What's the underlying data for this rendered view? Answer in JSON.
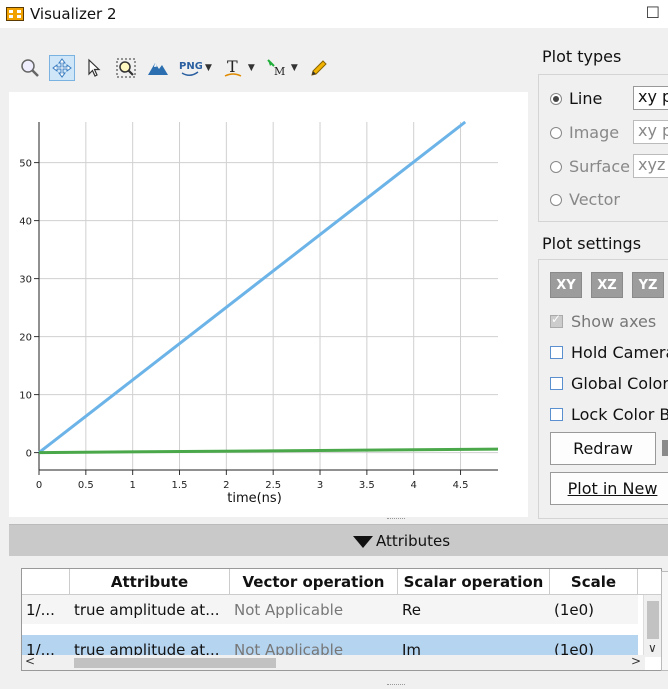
{
  "window": {
    "title": "Visualizer 2",
    "restore_glyph": "☐"
  },
  "toolbar": {
    "items": [
      {
        "name": "zoom-icon",
        "active": false
      },
      {
        "name": "pan-icon",
        "active": true
      },
      {
        "name": "select-cursor-icon",
        "active": false
      },
      {
        "name": "zoom-region-icon",
        "active": false
      },
      {
        "name": "mountain-icon",
        "active": false
      },
      {
        "name": "png-export-icon",
        "label": "PNG",
        "dropdown": true
      },
      {
        "name": "text-annotation-icon",
        "label": "T",
        "dropdown": true
      },
      {
        "name": "marker-icon",
        "label": "M",
        "dropdown": true
      },
      {
        "name": "pencil-icon",
        "active": false
      }
    ]
  },
  "chart_data": {
    "type": "line",
    "xlabel": "time(ns)",
    "xlim": [
      0,
      4.9
    ],
    "ylim": [
      -3,
      57
    ],
    "xticks": [
      0,
      0.5,
      1,
      1.5,
      2,
      2.5,
      3,
      3.5,
      4,
      4.5
    ],
    "yticks": [
      0,
      10,
      20,
      30,
      40,
      50
    ],
    "grid": true,
    "series": [
      {
        "x": [
          0,
          4.55
        ],
        "y": [
          0,
          57
        ],
        "color": "#6cb4e8"
      },
      {
        "x": [
          0,
          4.9
        ],
        "y": [
          0,
          0.6
        ],
        "color": "#4aa84a"
      }
    ]
  },
  "plot_types": {
    "title": "Plot types",
    "options": [
      {
        "label": "Line",
        "selected": true,
        "enabled": true,
        "input": "xy p"
      },
      {
        "label": "Image",
        "selected": false,
        "enabled": false,
        "input": "xy p"
      },
      {
        "label": "Surface",
        "selected": false,
        "enabled": false,
        "input": "xyz"
      },
      {
        "label": "Vector",
        "selected": false,
        "enabled": false,
        "input": ""
      }
    ]
  },
  "plot_settings": {
    "title": "Plot settings",
    "view_buttons": [
      "XY",
      "XZ",
      "YZ"
    ],
    "show_axes": "Show axes",
    "hold_camera": "Hold Camera",
    "global_color": "Global Color",
    "lock_color": "Lock Color B",
    "redraw": "Redraw",
    "plot_in_new": "Plot in New"
  },
  "attributes": {
    "title": "Attributes",
    "columns": [
      "Attribute",
      "Vector operation",
      "Scalar operation",
      "Scale"
    ],
    "rows": [
      {
        "index": "1/...",
        "attribute": "true amplitude at...",
        "vector_op": "Not Applicable",
        "scalar_op": "Re",
        "scale": "(1e0)"
      },
      {
        "index": "1/...",
        "attribute": "true amplitude at...",
        "vector_op": "Not Applicable",
        "scalar_op": "Im",
        "scale": "(1e0)"
      }
    ]
  }
}
